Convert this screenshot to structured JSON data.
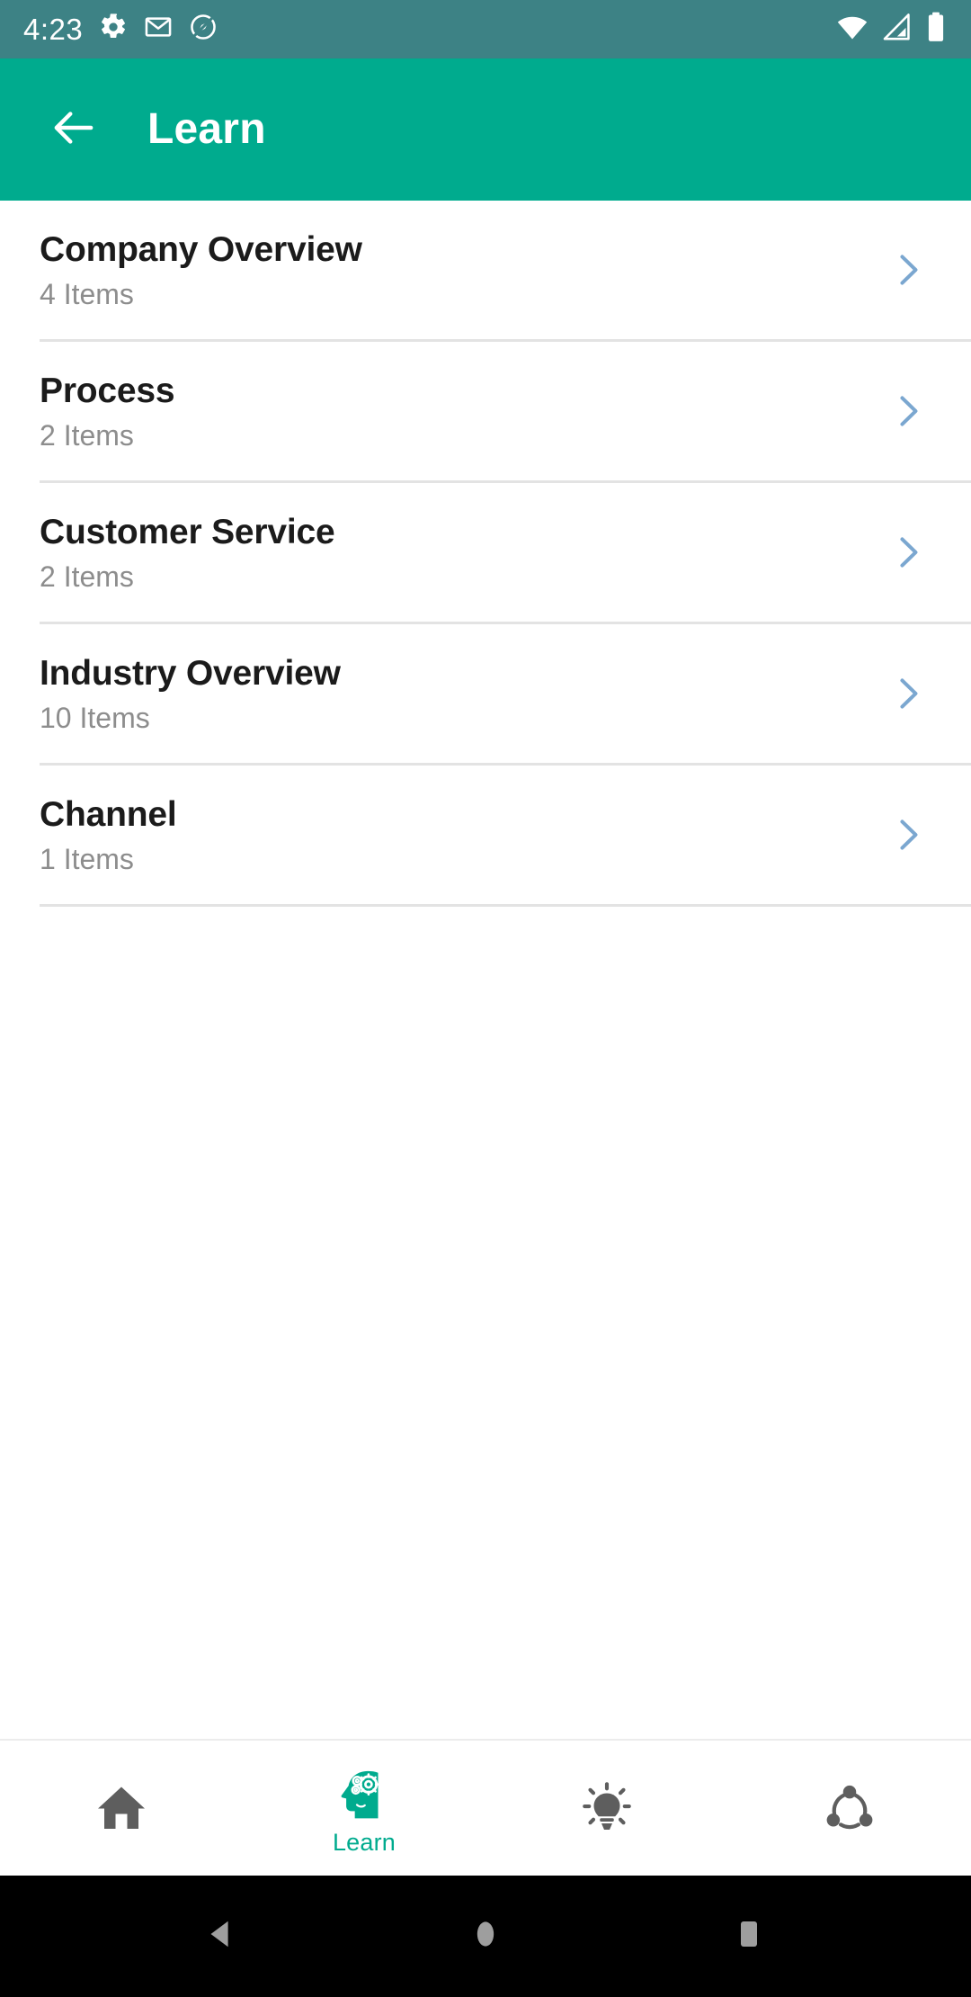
{
  "status_bar": {
    "clock": "4:23",
    "left_icons": [
      "settings-gear-icon",
      "gmail-icon",
      "compass-record-icon"
    ],
    "right_icons": [
      "wifi-icon",
      "cellular-signal-icon",
      "battery-icon"
    ],
    "background_color": "#3d8285",
    "foreground_color": "#ffffff"
  },
  "app_bar": {
    "title": "Learn",
    "back_icon": "arrow-left-icon",
    "background_color": "#00ab8e",
    "text_color": "#ffffff"
  },
  "list": {
    "chevron_color": "#7ba7d0",
    "title_color": "#1b1b1b",
    "subtitle_color": "#8d8d8d",
    "divider_color": "#e3e3e3",
    "items": [
      {
        "title": "Company Overview",
        "subtitle": "4 Items",
        "chevron": "chevron-right-icon"
      },
      {
        "title": "Process",
        "subtitle": "2 Items",
        "chevron": "chevron-right-icon"
      },
      {
        "title": "Customer Service",
        "subtitle": "2 Items",
        "chevron": "chevron-right-icon"
      },
      {
        "title": "Industry Overview",
        "subtitle": "10 Items",
        "chevron": "chevron-right-icon"
      },
      {
        "title": "Channel",
        "subtitle": "1 Items",
        "chevron": "chevron-right-icon"
      }
    ]
  },
  "bottom_nav": {
    "active_color": "#00ab8e",
    "inactive_color": "#5e5e5e",
    "items": [
      {
        "label": "",
        "icon": "home-icon",
        "active": false
      },
      {
        "label": "Learn",
        "icon": "head-gears-icon",
        "active": true
      },
      {
        "label": "",
        "icon": "lightbulb-icon",
        "active": false
      },
      {
        "label": "",
        "icon": "share-network-icon",
        "active": false
      }
    ]
  },
  "system_nav": {
    "background_color": "#000000",
    "icon_color": "#9e9e9e",
    "buttons": [
      {
        "icon": "android-back-icon"
      },
      {
        "icon": "android-home-icon"
      },
      {
        "icon": "android-recents-icon"
      }
    ]
  }
}
